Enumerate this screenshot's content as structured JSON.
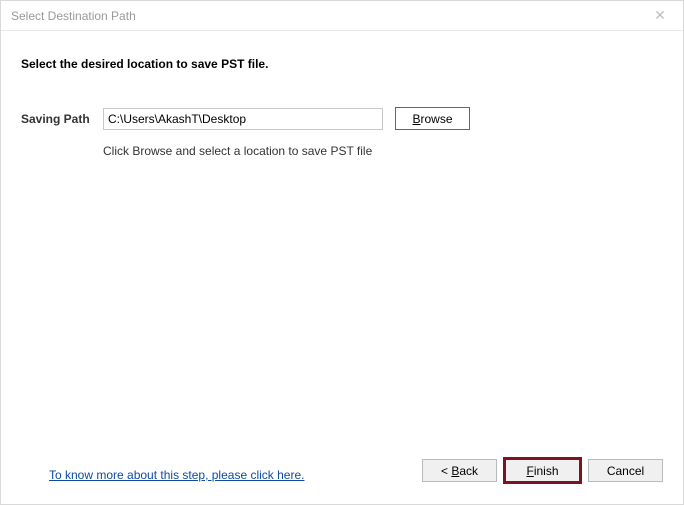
{
  "title": "Select Destination Path",
  "instruction": "Select the desired location to save PST file.",
  "form": {
    "savingPathLabel": "Saving Path",
    "savingPathValue": "C:\\Users\\AkashT\\Desktop",
    "browseLabel": "Browse",
    "hint": "Click Browse and select a location to save PST file"
  },
  "helpLink": "To know more about this step, please click here.",
  "buttons": {
    "back": "< Back",
    "finish": "Finish",
    "cancel": "Cancel"
  }
}
